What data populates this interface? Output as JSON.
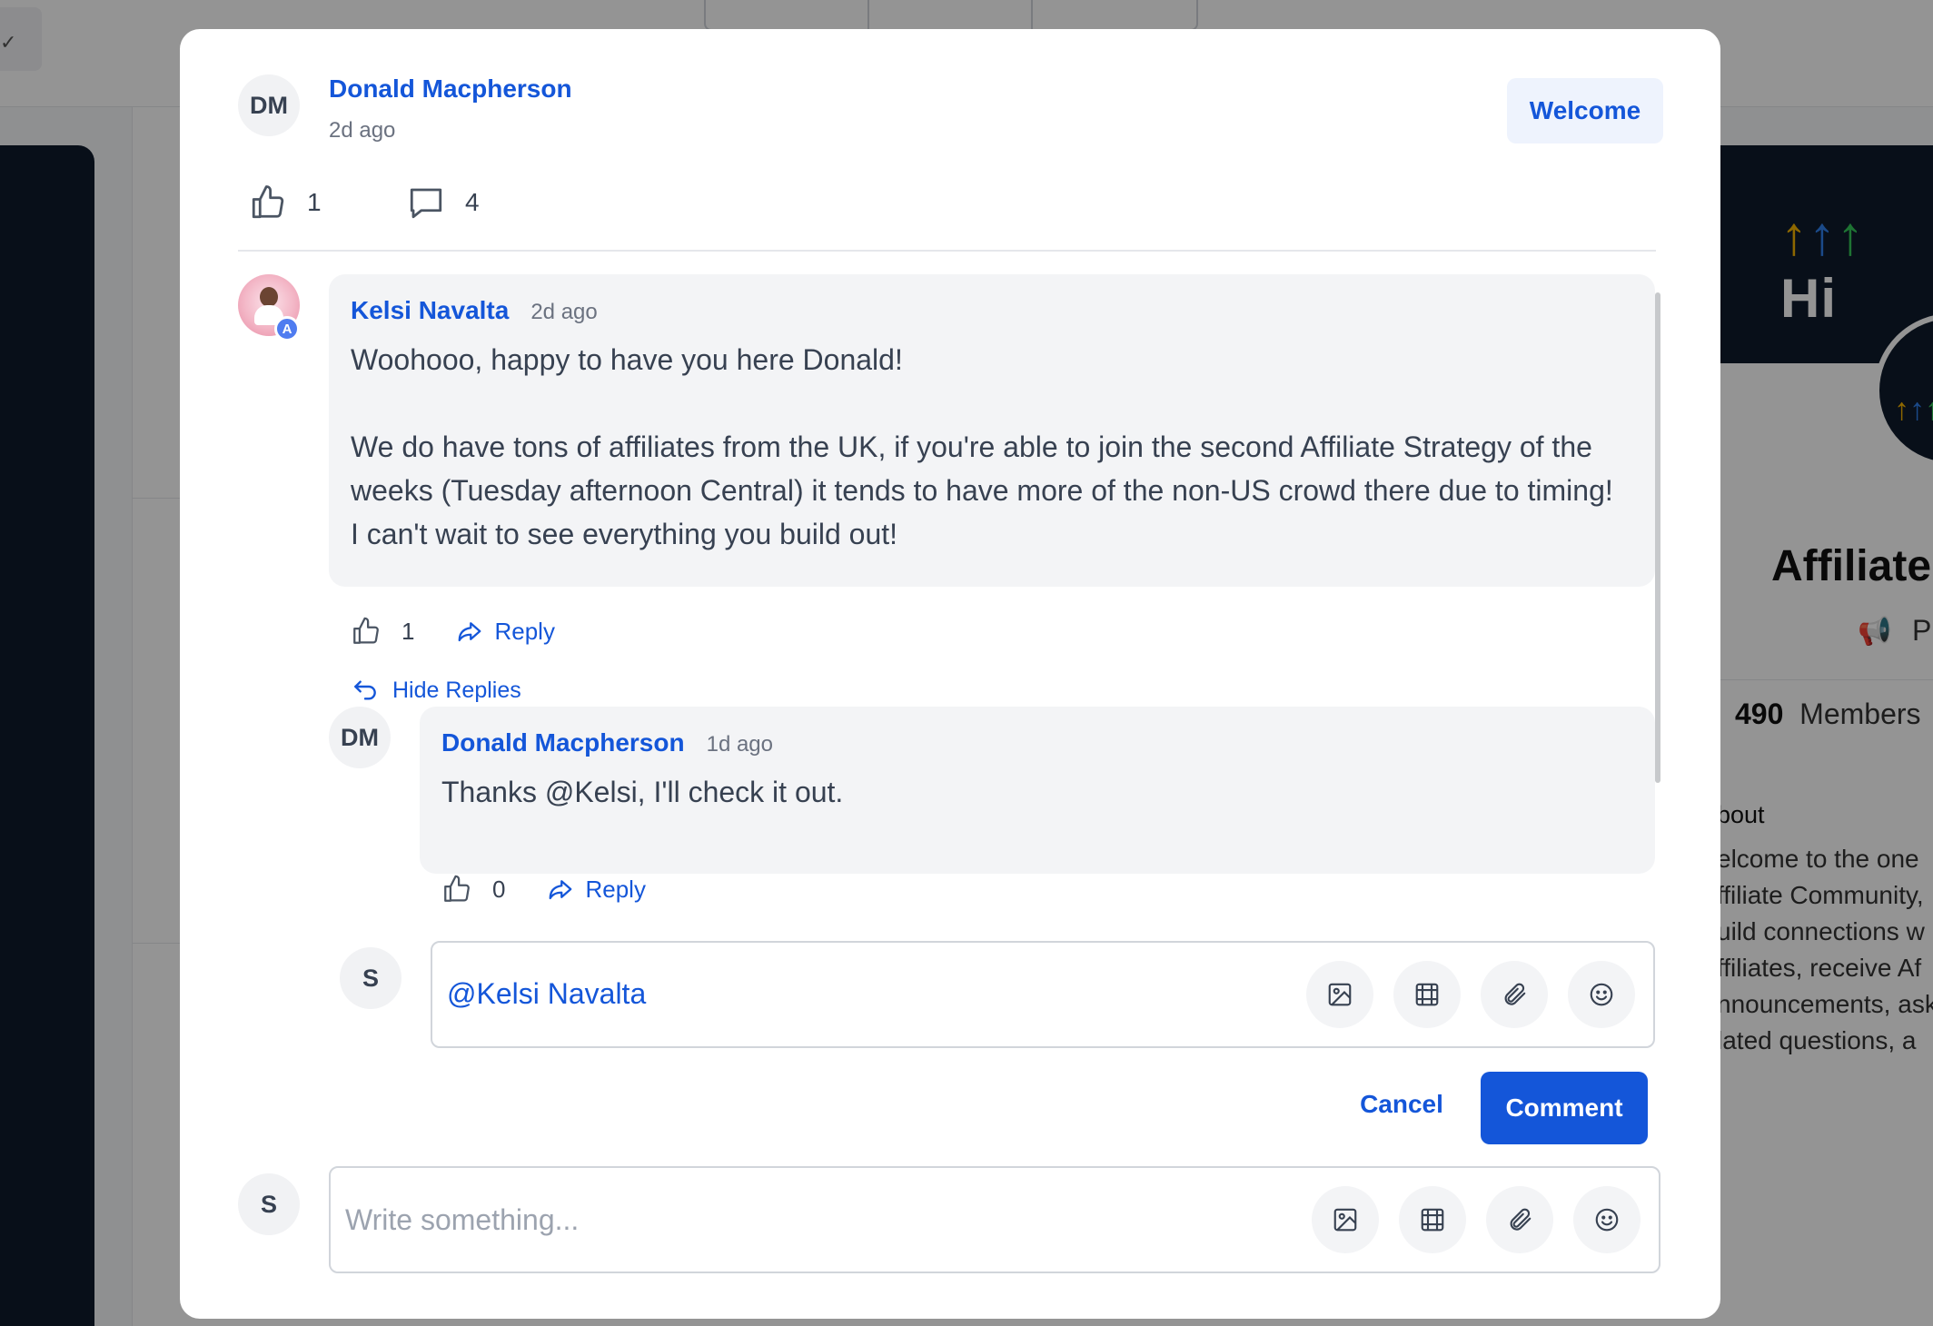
{
  "background": {
    "logo_text": "Hi",
    "community_title": "Affiliate",
    "privacy_label": "P",
    "members_count": "490",
    "members_label": "Members",
    "about_heading": "bout",
    "about_lines": [
      "elcome to the one",
      "ffiliate Community,",
      "uild connections w",
      "ffiliates, receive Af",
      "nnouncements, ask",
      "lated questions, a"
    ]
  },
  "post": {
    "author_initials": "DM",
    "author_name": "Donald Macpherson",
    "time": "2d ago",
    "tag_label": "Welcome",
    "likes": "1",
    "comments": "4"
  },
  "comments": [
    {
      "author_name": "Kelsi Navalta",
      "badge": "A",
      "time": "2d ago",
      "paragraphs": [
        "Woohooo, happy to have you here Donald!",
        "We do have tons of affiliates from the UK, if you're able to join the second Affiliate Strategy of the weeks (Tuesday afternoon Central) it tends to have more of the non-US crowd there due to timing! I can't wait to see everything you build out!"
      ],
      "likes": "1",
      "reply_label": "Reply",
      "hide_replies_label": "Hide Replies"
    },
    {
      "author_initials": "DM",
      "author_name": "Donald Macpherson",
      "time": "1d ago",
      "text": "Thanks @Kelsi, I'll check it out.",
      "likes": "0",
      "reply_label": "Reply"
    }
  ],
  "reply_editor": {
    "user_initial": "S",
    "mention_value": "@Kelsi Navalta",
    "cancel_label": "Cancel",
    "submit_label": "Comment"
  },
  "main_editor": {
    "user_initial": "S",
    "placeholder": "Write something..."
  },
  "icons": [
    "thumbs-up-icon",
    "comment-icon",
    "reply-arrow-icon",
    "hide-replies-icon",
    "image-icon",
    "gif-icon",
    "paperclip-icon",
    "emoji-icon"
  ],
  "colors": {
    "accent": "#1456d9",
    "bubble": "#f3f4f6",
    "tag_bg": "#eef3fd",
    "dark_panel": "#0e1a2b"
  }
}
